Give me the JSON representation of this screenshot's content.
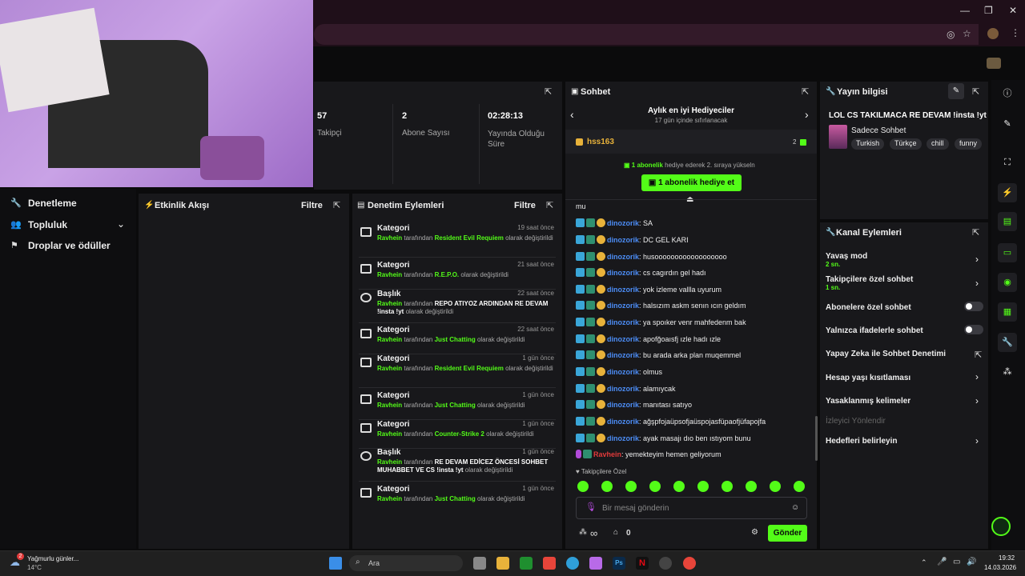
{
  "window": {
    "min": "—",
    "max": "❐",
    "close": "✕"
  },
  "left_nav": {
    "items": [
      "Denetleme",
      "Topluluk",
      "Droplar ve ödüller"
    ]
  },
  "stats": [
    {
      "value": "57",
      "label": "Takipçi"
    },
    {
      "value": "2",
      "label": "Abone Sayısı"
    },
    {
      "value": "02:28:13",
      "label": "Yayında Olduğu Süre"
    }
  ],
  "activity": {
    "title": "Etkinlik Akışı",
    "filter": "Filtre"
  },
  "moderation": {
    "title": "Denetim Eylemleri",
    "filter": "Filtre",
    "rows": [
      {
        "title": "Kategori",
        "time": "19 saat önce",
        "user": "Ravhein",
        "pre": " tarafından ",
        "value": "Resident Evil Requiem",
        "post": " olarak değiştirildi"
      },
      {
        "title": "Kategori",
        "time": "21 saat önce",
        "user": "Ravhein",
        "pre": " tarafından ",
        "value": "R.E.P.O.",
        "post": " olarak değiştirildi"
      },
      {
        "title": "Başlık",
        "time": "22 saat önce",
        "user": "Ravhein",
        "pre": " tarafından ",
        "value": "REPO ATIYOZ ARDINDAN RE DEVAM !insta !yt",
        "post": " olarak değiştirildi"
      },
      {
        "title": "Kategori",
        "time": "22 saat önce",
        "user": "Ravhein",
        "pre": " tarafından ",
        "value": "Just Chatting",
        "post": " olarak değiştirildi"
      },
      {
        "title": "Kategori",
        "time": "1 gün önce",
        "user": "Ravhein",
        "pre": " tarafından ",
        "value": "Resident Evil Requiem",
        "post": " olarak değiştirildi"
      },
      {
        "title": "Kategori",
        "time": "1 gün önce",
        "user": "Ravhein",
        "pre": " tarafından ",
        "value": "Just Chatting",
        "post": " olarak değiştirildi"
      },
      {
        "title": "Kategori",
        "time": "1 gün önce",
        "user": "Ravhein",
        "pre": " tarafından ",
        "value": "Counter-Strike 2",
        "post": " olarak değiştirildi"
      },
      {
        "title": "Başlık",
        "time": "1 gün önce",
        "user": "Ravhein",
        "pre": " tarafından ",
        "value": "RE DEVAM EDİCEZ ÖNCESİ SOHBET MUHABBET VE CS !insta !yt",
        "post": " olarak değiştirildi"
      },
      {
        "title": "Kategori",
        "time": "1 gün önce",
        "user": "Ravhein",
        "pre": " tarafından ",
        "value": "Just Chatting",
        "post": " olarak değiştirildi"
      }
    ]
  },
  "chat": {
    "title": "Sohbet",
    "gifters_title": "Aylık en iyi Hediyeciler",
    "gifters_sub": "17 gün içinde sıfırlanacak",
    "top_user": "hss163",
    "top_count": "2",
    "promo_count": "1 abonelik",
    "promo_text": " hediye ederek 2. sıraya yükseln",
    "gift_button": "1 abonelik hediye et",
    "partial": "mu",
    "messages": [
      {
        "user": "dinozorik",
        "text": ": SA"
      },
      {
        "user": "dinozorik",
        "text": ": DC GEL KARI"
      },
      {
        "user": "dinozorik",
        "text": ": husoooooooooooooooooo"
      },
      {
        "user": "dinozorik",
        "text": ": cs cagırdın gel hadı"
      },
      {
        "user": "dinozorik",
        "text": ": yok izleme vallla uyurum"
      },
      {
        "user": "dinozorik",
        "text": ": halsızım askm senın ıcın geldım"
      },
      {
        "user": "dinozorik",
        "text": ": ya spoıker venr mahfedenm bak"
      },
      {
        "user": "dinozorik",
        "text": ": apofğoaısfj ızle hadı ızle"
      },
      {
        "user": "dinozorik",
        "text": ": bu arada arka plan muqemmel"
      },
      {
        "user": "dinozorik",
        "text": ": olmus"
      },
      {
        "user": "dinozorik",
        "text": ": alamıycak"
      },
      {
        "user": "dinozorik",
        "text": ": manıtası satıyo"
      },
      {
        "user": "dinozorik",
        "text": ": ağşpfojaüpsofjaüspojasfüpaofjüfapojfa"
      },
      {
        "user": "dinozorik",
        "text": ": ayak masajı dıo ben ıstıyom bunu"
      }
    ],
    "own_user": "Ravhein",
    "own_text": ": yemekteyim hemen geliyorum",
    "followers_only": "Takipçilere Özel",
    "input_placeholder": "Bir mesaj gönderin",
    "infinity": "∞",
    "points": "0",
    "send": "Gönder"
  },
  "stream_info": {
    "title": "Yayın bilgisi",
    "stream_title": "LOL CS TAKILMACA RE DEVAM !insta !yt",
    "category": "Sadece Sohbet",
    "tags": [
      "Turkish",
      "Türkçe",
      "chill",
      "funny"
    ]
  },
  "channel_actions": {
    "title": "Kanal Eylemleri",
    "rows": [
      {
        "label": "Yavaş mod",
        "sub": "2 sn."
      },
      {
        "label": "Takipçilere özel sohbet",
        "sub": "1 sn."
      },
      {
        "label": "Abonelere özel sohbet"
      },
      {
        "label": "Yalnızca ifadelerle sohbet"
      },
      {
        "label": "Yapay Zeka ile Sohbet Denetimi"
      },
      {
        "label": "Hesap yaşı kısıtlaması"
      },
      {
        "label": "Yasaklanmış kelimeler"
      },
      {
        "label": "İzleyici Yönlendir"
      },
      {
        "label": "Hedefleri belirleyin"
      }
    ]
  },
  "taskbar": {
    "weather": "Yağmurlu günler...",
    "temp": "14°C",
    "weather_badge": "2",
    "search": "Ara",
    "time": "19:32",
    "date": "14.03.2026"
  },
  "colors": {
    "accent": "#53fc18",
    "panel": "#18181b",
    "bg": "#0b0b0c",
    "username": "#4c8df6"
  }
}
